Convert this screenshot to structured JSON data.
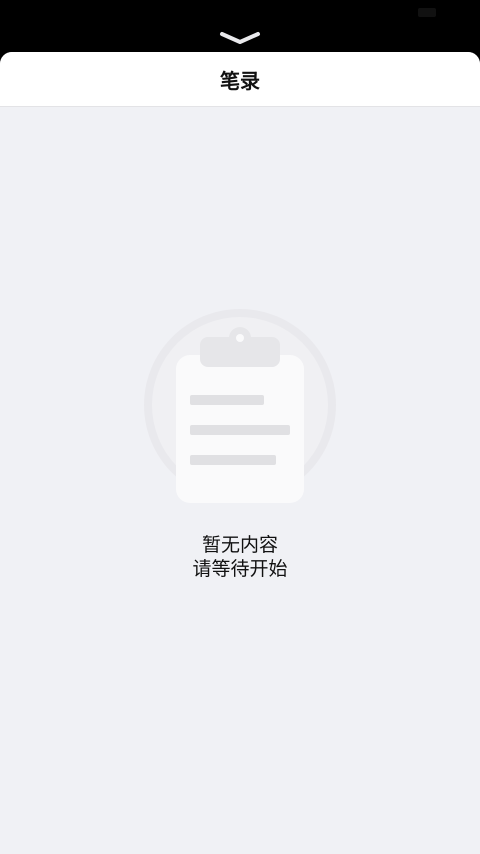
{
  "sheet": {
    "title": "笔录"
  },
  "empty_state": {
    "line1": "暂无内容",
    "line2": "请等待开始",
    "icon": "clipboard-icon"
  },
  "colors": {
    "sheet_background": "#f0f1f5",
    "header_background": "#ffffff",
    "illustration_circle": "#e6e6ea",
    "illustration_paper": "#f7f7f9",
    "illustration_lines": "#dcdcdf"
  }
}
